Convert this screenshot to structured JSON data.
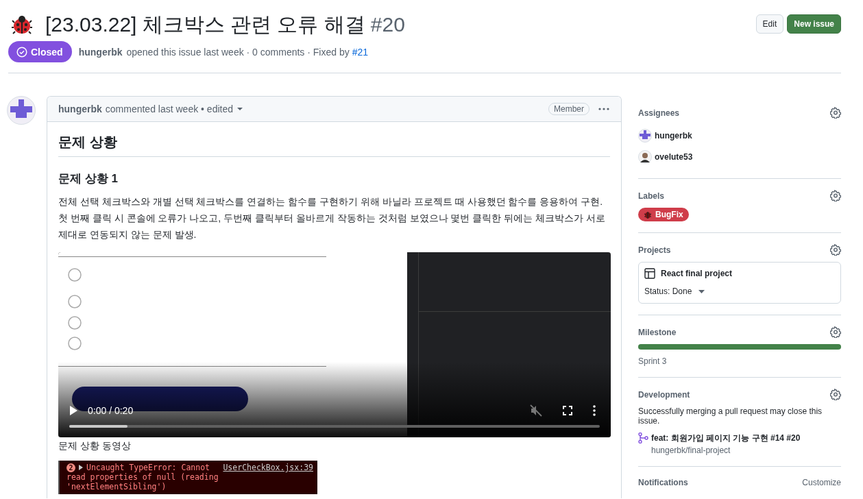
{
  "issue": {
    "title": "[23.03.22] 체크박스 관련 오류 해결",
    "number": "#20",
    "closed": true,
    "state_label": "Closed",
    "author": "hungerbk",
    "meta": "opened this issue last week · 0 comments · Fixed by",
    "fixed_by": "#21"
  },
  "header_buttons": [
    {
      "label": "Edit",
      "kind": "default"
    },
    {
      "label": "New issue",
      "kind": "primary"
    }
  ],
  "comment": {
    "author": "hungerbk",
    "meta": "commented last week • edited",
    "badge": "Member",
    "heading": "문제 상황",
    "subheading": "문제 상황 1",
    "paragraph": "전체 선택 체크박스와 개별 선택 체크박스를 연결하는 함수를 구현하기 위해 바닐라 프로젝트 때 사용했던 함수를 응용하여 구현. 첫 번째 클릭 시 콘솔에 오류가 나오고, 두번째 클릭부터 올바르게 작동하는 것처럼 보였으나 몇번 클릭한 뒤에는 체크박스가 서로 제대로 연동되지 않는 문제 발생.",
    "video": {
      "kind": "picture",
      "time": "0:00 / 0:20",
      "level": 0.11,
      "muted": true
    },
    "caption": "문제 상황 동영상",
    "console": {
      "count": "2",
      "source": "UserCheckBox.jsx:39",
      "lines": [
        "Uncaught TypeError: Cannot",
        "read properties of null (reading",
        "'nextElementSibling')"
      ]
    }
  },
  "sidebar": [
    {
      "kind": "assignees",
      "title": "Assignees",
      "items": [
        {
          "name": "hungerbk",
          "kind": "identicon"
        },
        {
          "name": "ovelute53",
          "kind": "person"
        }
      ]
    },
    {
      "kind": "labels",
      "title": "Labels",
      "items": [
        {
          "name": "BugFix",
          "color": "#cf3d4a"
        }
      ]
    },
    {
      "kind": "projects",
      "title": "Projects",
      "items": [
        {
          "name": "React final project",
          "status": "Status: Done"
        }
      ]
    },
    {
      "kind": "milestone",
      "title": "Milestone",
      "level": 1,
      "name": "Sprint 3"
    },
    {
      "kind": "development",
      "title": "Development",
      "note": "Successfully merging a pull request may close this issue.",
      "items": [
        {
          "title": "feat: 회원가입 페이지 기능 구현 #14 #20",
          "repo": "hungerbk/final-project"
        }
      ]
    },
    {
      "kind": "notifications",
      "title": "Notifications",
      "action": "Customize"
    }
  ]
}
